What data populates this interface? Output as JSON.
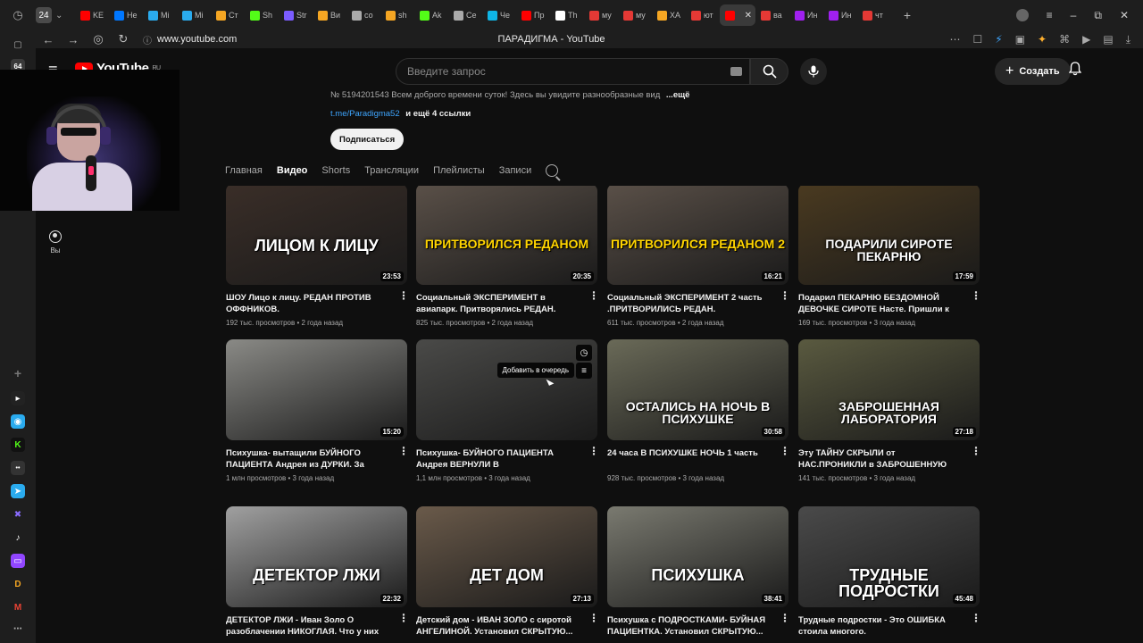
{
  "browser": {
    "tab_count": "24",
    "tabs": [
      {
        "label": "KE",
        "color": "#ff0000"
      },
      {
        "label": "Не",
        "color": "#0077ff"
      },
      {
        "label": "Mi",
        "color": "#2aabee"
      },
      {
        "label": "Mi",
        "color": "#2aabee"
      },
      {
        "label": "Ст",
        "color": "#f5a623"
      },
      {
        "label": "Sh",
        "color": "#53fc18"
      },
      {
        "label": "Str",
        "color": "#7b5cff"
      },
      {
        "label": "Ви",
        "color": "#f5a623"
      },
      {
        "label": "со",
        "color": "#aaaaaa"
      },
      {
        "label": "sh",
        "color": "#f5a623"
      },
      {
        "label": "Ak",
        "color": "#53fc18"
      },
      {
        "label": "Се",
        "color": "#aaaaaa"
      },
      {
        "label": "Че",
        "color": "#0fb5e5"
      },
      {
        "label": "Пр",
        "color": "#ff0000"
      },
      {
        "label": "Th",
        "color": "#ffffff"
      },
      {
        "label": "му",
        "color": "#e53935"
      },
      {
        "label": "му",
        "color": "#e53935"
      },
      {
        "label": "ХА",
        "color": "#f5a623"
      },
      {
        "label": "ют",
        "color": "#e53935"
      },
      {
        "label": "",
        "color": "#ff0000",
        "active": true
      },
      {
        "label": "ва",
        "color": "#e53935"
      },
      {
        "label": "Ин",
        "color": "#a020f0"
      },
      {
        "label": "Ин",
        "color": "#a020f0"
      },
      {
        "label": "чт",
        "color": "#e53935"
      }
    ],
    "url": "www.youtube.com",
    "page_title": "ПАРАДИГМА - YouTube",
    "sidebar_counter": "64"
  },
  "youtube": {
    "logo_text": "YouTube",
    "logo_region": "RU",
    "search_placeholder": "Введите запрос",
    "create_label": "Создать",
    "you_label": "Вы",
    "description": "№ 5194201543 Всем доброго времени суток! Здесь вы увидите разнообразные вид",
    "description_more": "...ещё",
    "link_text": "t.me/Paradigma52",
    "links_more": "и ещё 4 ссылки",
    "subscribe_label": "Подписаться",
    "tabs": [
      "Главная",
      "Видео",
      "Shorts",
      "Трансляции",
      "Плейлисты",
      "Записи"
    ],
    "active_tab": "Видео",
    "queue_tooltip": "Добавить в очередь"
  },
  "videos": [
    {
      "title": "ШОУ Лицо к лицу. РЕДАН ПРОТИВ ОФФНИКОВ.",
      "views": "192 тыс. просмотров",
      "age": "2 года назад",
      "duration": "23:53",
      "caption": "ЛИЦОМ К ЛИЦУ",
      "bg": "#3a2e28",
      "capColor": "#ffffff"
    },
    {
      "title": "Социальный ЭКСПЕРИМЕНТ в авиапарк. Притворялись РЕДАН. ОФФНИКИ...",
      "views": "825 тыс. просмотров",
      "age": "2 года назад",
      "duration": "20:35",
      "caption": "ПРИТВОРИЛСЯ РЕДАНОМ",
      "bg": "#5a5048",
      "capColor": "#ffd400"
    },
    {
      "title": "Социальный ЭКСПЕРИМЕНТ 2 часть .ПРИТВОРИЛИСЬ РЕДАН.",
      "views": "611 тыс. просмотров",
      "age": "2 года назад",
      "duration": "16:21",
      "caption": "ПРИТВОРИЛСЯ РЕДАНОМ 2",
      "bg": "#5a5048",
      "capColor": "#ffd400"
    },
    {
      "title": "Подарил ПЕКАРНЮ БЕЗДОМНОЙ ДЕВОЧКЕ СИРОТЕ Насте. Пришли к БРА...",
      "views": "169 тыс. просмотров",
      "age": "3 года назад",
      "duration": "17:59",
      "caption": "ПОДАРИЛИ СИРОТЕ ПЕКАРНЮ",
      "bg": "#4a3a20",
      "capColor": "#ffffff"
    },
    {
      "title": "Психушка- вытащили БУЙНОГО ПАЦИЕНТА Андрея из ДУРКИ. За нами...",
      "views": "1 млн просмотров",
      "age": "3 года назад",
      "duration": "15:20",
      "caption": "",
      "bg": "#8a8a86",
      "capColor": "#ffffff"
    },
    {
      "title": "Психушка- БУЙНОГО ПАЦИЕНТА Андрея ВЕРНУЛИ В ДУРКУ.САНИТАРЫ...",
      "views": "1,1 млн просмотров",
      "age": "3 года назад",
      "duration": "",
      "caption": "",
      "bg": "#4a4a48",
      "capColor": "#ffffff"
    },
    {
      "title": "24 часа В ПСИХУШКЕ НОЧЬ 1 часть",
      "views": "928 тыс. просмотров",
      "age": "3 года назад",
      "duration": "30:58",
      "caption": "ОСТАЛИСЬ НА НОЧЬ В ПСИХУШКЕ",
      "bg": "#6a6a58",
      "capColor": "#ffffff"
    },
    {
      "title": "Эту ТАЙНУ СКРЫЛИ от НАС.ПРОНИКЛИ в ЗАБРОШЕННУЮ ЛАБОРАТОРИЮ под...",
      "views": "141 тыс. просмотров",
      "age": "3 года назад",
      "duration": "27:18",
      "caption": "ЗАБРОШЕННАЯ ЛАБОРАТОРИЯ",
      "bg": "#5a5a40",
      "capColor": "#ffffff"
    },
    {
      "title": "ДЕТЕКТОР ЛЖИ - Иван Золо О разоблачении НИКОГЛАЯ. Что у них с...",
      "views": "",
      "age": "",
      "duration": "22:32",
      "caption": "ДЕТЕКТОР ЛЖИ",
      "bg": "#a0a0a0",
      "capColor": "#ffffff"
    },
    {
      "title": "Детский дом - ИВАН ЗОЛО с сиротой АНГЕЛИНОЙ. Установил СКРЫТУЮ...",
      "views": "",
      "age": "",
      "duration": "27:13",
      "caption": "ДЕТ ДОМ",
      "bg": "#6a5a4a",
      "capColor": "#ffffff"
    },
    {
      "title": "Психушка с ПОДРОСТКАМИ- БУЙНАЯ ПАЦИЕНТКА. Установил СКРЫТУЮ...",
      "views": "",
      "age": "",
      "duration": "38:41",
      "caption": "ПСИХУШКА",
      "bg": "#7a7a70",
      "capColor": "#ffffff"
    },
    {
      "title": "Трудные подростки - Это ОШИБКА стоила многого.",
      "views": "",
      "age": "",
      "duration": "45:48",
      "caption": "ТРУДНЫЕ ПОДРОСТКИ",
      "bg": "#4a4a4a",
      "capColor": "#ffffff"
    }
  ]
}
